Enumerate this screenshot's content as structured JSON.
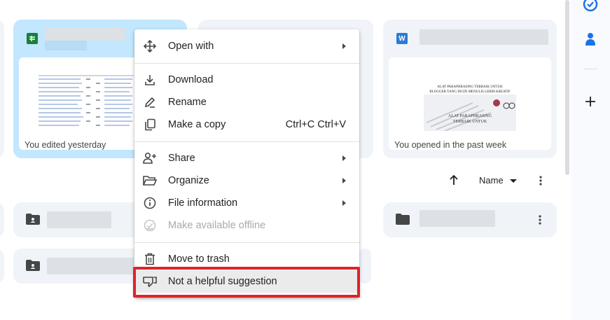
{
  "cards": [
    {
      "type_badge": "sheets",
      "footer": "You edited yesterday",
      "selected": true
    },
    {
      "type_badge": "word",
      "badge_letter": "W",
      "footer": "You opened in the past week",
      "selected": false,
      "thumb_text": [
        "ALAT PARAPHRASING TERBAIK UNTUK",
        "BLOGGER YANG INGIN MENULIS LEBIH KREATIF",
        "ALAT PARAPHRASING",
        "TERBAIK UNTUK"
      ]
    }
  ],
  "sort": {
    "label": "Name"
  },
  "menu": {
    "items": [
      {
        "label": "Open with",
        "icon": "move-arrows-icon",
        "submenu": true
      },
      {
        "label": "Download",
        "icon": "download-icon"
      },
      {
        "label": "Rename",
        "icon": "pencil-icon"
      },
      {
        "label": "Make a copy",
        "icon": "copy-icon",
        "shortcut": "Ctrl+C Ctrl+V"
      },
      {
        "label": "Share",
        "icon": "person-add-icon",
        "submenu": true
      },
      {
        "label": "Organize",
        "icon": "folder-open-icon",
        "submenu": true
      },
      {
        "label": "File information",
        "icon": "info-icon",
        "submenu": true
      },
      {
        "label": "Make available offline",
        "icon": "offline-check-icon",
        "disabled": true
      },
      {
        "label": "Move to trash",
        "icon": "trash-icon"
      },
      {
        "label": "Not a helpful suggestion",
        "icon": "thumb-down-icon",
        "highlighted": true
      }
    ]
  },
  "colors": {
    "accent": "#c2e7ff",
    "highlight": "#e0232a",
    "sheets": "#188038",
    "word": "#2b7cd3"
  }
}
